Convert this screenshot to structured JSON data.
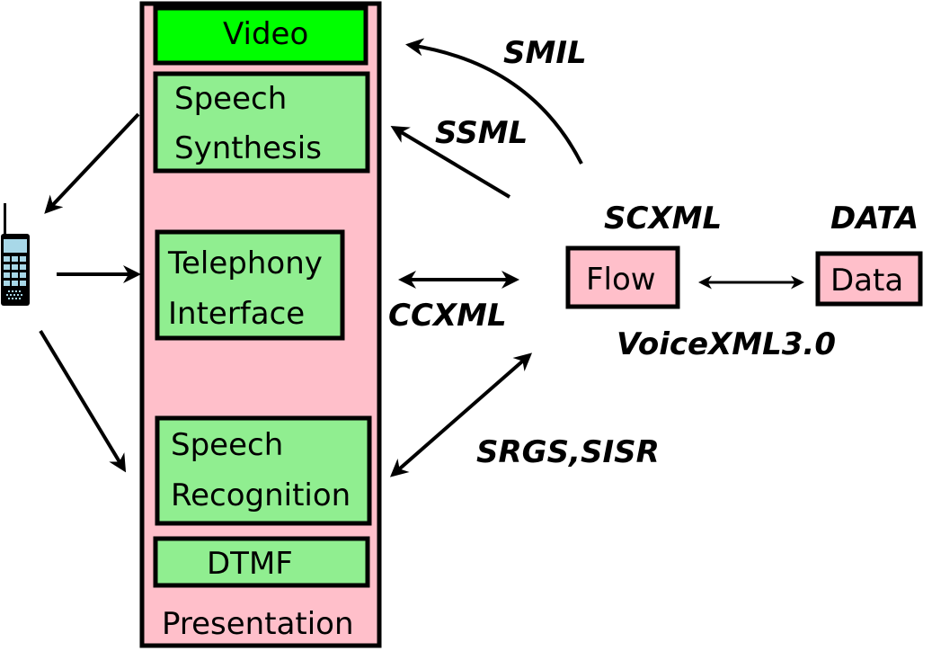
{
  "colors": {
    "presentation_fill": "#ffbfca",
    "component_fill": "#90ee90",
    "video_fill": "#00ff00",
    "node_fill": "#ffbfca",
    "stroke": "#000000",
    "phone_screen": "#a8d8e8"
  },
  "presentation": {
    "label": "Presentation",
    "components": {
      "video": "Video",
      "speech_synthesis": [
        "Speech",
        "Synthesis"
      ],
      "telephony_interface": [
        "Telephony",
        "Interface"
      ],
      "speech_recognition": [
        "Speech",
        "Recognition"
      ],
      "dtmf": "DTMF"
    }
  },
  "nodes": {
    "flow": "Flow",
    "data": "Data"
  },
  "labels": {
    "smil": "SMIL",
    "ssml": "SSML",
    "ccxml": "CCXML",
    "srgs_sisr": "SRGS,SISR",
    "scxml": "SCXML",
    "data_title": "DATA",
    "voicexml": "VoiceXML3.0"
  },
  "phone": {
    "icon": "mobile-phone-icon"
  }
}
